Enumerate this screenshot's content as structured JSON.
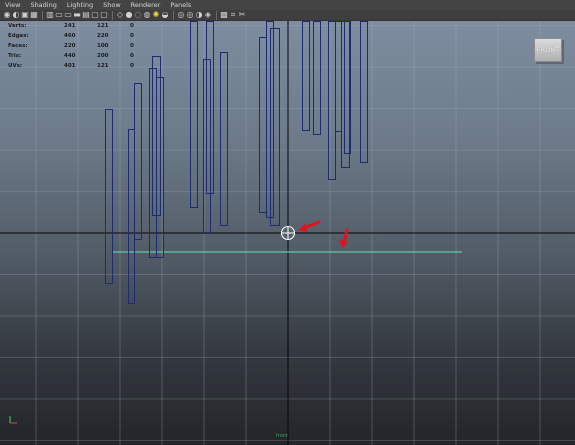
{
  "menu": [
    "View",
    "Shading",
    "Lighting",
    "Show",
    "Renderer",
    "Panels"
  ],
  "toolbar_icons": [
    "select-camera-icon",
    "camera-attributes-icon",
    "bookmark-icon",
    "image-plane-icon",
    "grid-icon",
    "film-gate-icon",
    "resolution-gate-icon",
    "gate-mask-icon",
    "field-chart-icon",
    "safe-action-icon",
    "safe-title-icon",
    "wireframe-icon",
    "smooth-shade-icon",
    "bounding-box-icon",
    "textured-icon",
    "use-all-lights-icon",
    "shadows-icon",
    "xray-icon",
    "xray-joints-icon",
    "backface-culling-icon",
    "smooth-wireframe-icon",
    "isolate-select-icon",
    "crop-icon",
    "exposure-icon"
  ],
  "heads_up": [
    {
      "label": "Verts:",
      "c1": "241",
      "c2": "121",
      "c3": "0"
    },
    {
      "label": "Edges:",
      "c1": "460",
      "c2": "220",
      "c3": "0"
    },
    {
      "label": "Faces:",
      "c1": "220",
      "c2": "100",
      "c3": "0"
    },
    {
      "label": "Tris:",
      "c1": "440",
      "c2": "200",
      "c3": "0"
    },
    {
      "label": "UVs:",
      "c1": "401",
      "c2": "121",
      "c3": "0"
    }
  ],
  "view_cube": "FRONT",
  "camera_label": "front",
  "colors": {
    "wire": "#1e2a72",
    "grid": "#aab4c0",
    "axis": "#050505",
    "ground": "#62c9a3",
    "arrow": "#e0141c"
  }
}
